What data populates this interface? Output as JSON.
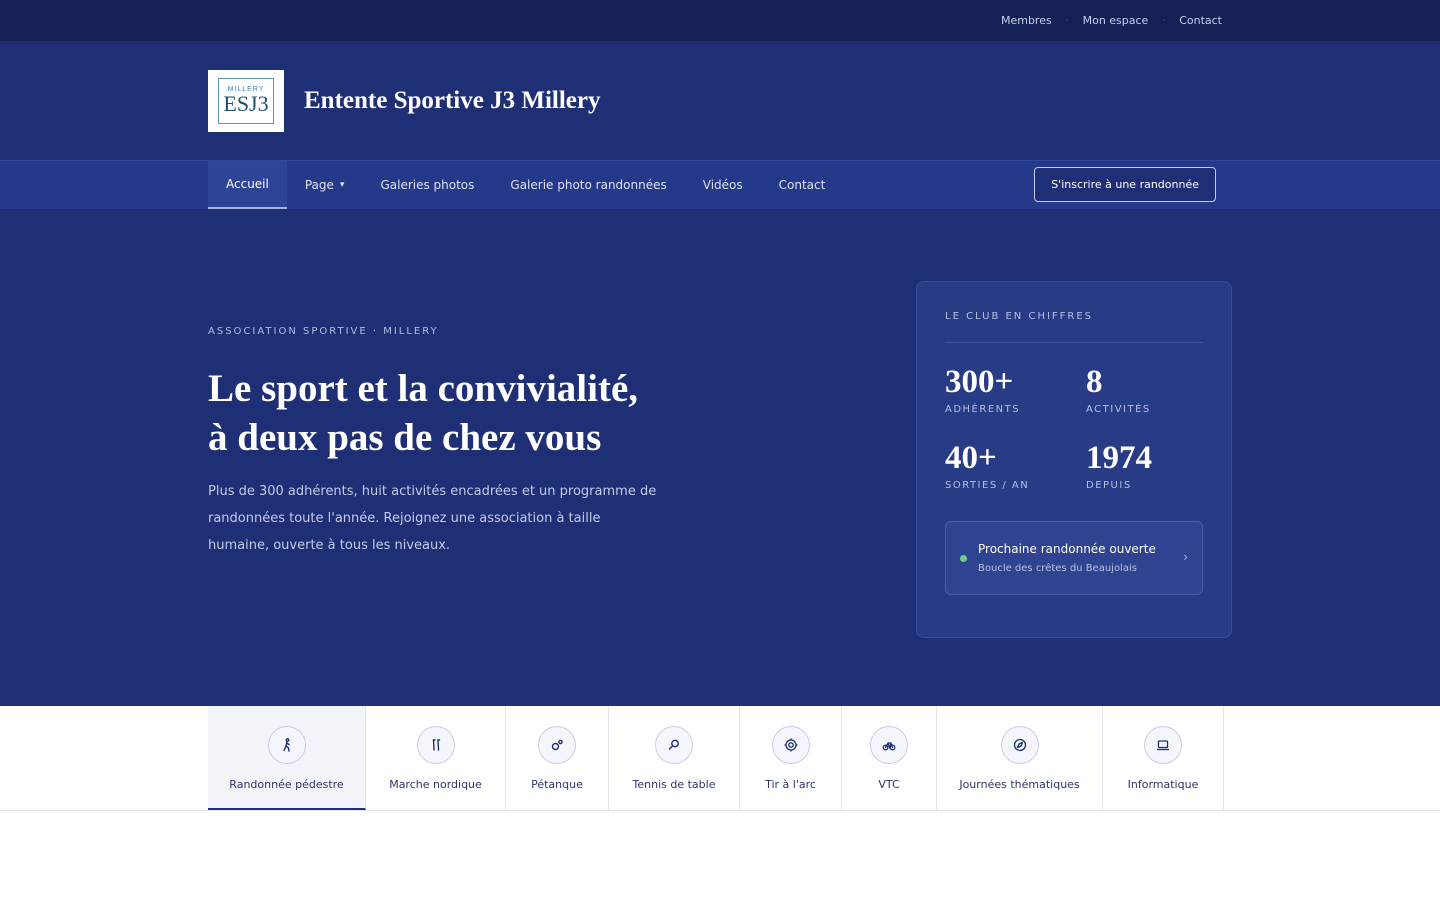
{
  "topbar": {
    "links": [
      "Membres",
      "Mon espace",
      "Contact"
    ]
  },
  "header": {
    "logo_top": "MILLERY",
    "logo_main": "ESJ3",
    "title": "Entente Sportive J3 Millery"
  },
  "nav": {
    "items": [
      "Accueil",
      "Page",
      "Galeries photos",
      "Galerie photo randonnées",
      "Vidéos",
      "Contact"
    ],
    "active": "Accueil",
    "cta": "S'inscrire à une randonnée"
  },
  "hero": {
    "kicker": "ASSOCIATION SPORTIVE · MILLERY",
    "headline_line1": "Le sport et la convivialité,",
    "headline_line2": "à deux pas de chez vous",
    "lead": "Plus de 300 adhérents, huit activités encadrées et un programme de randonnées toute l'année. Rejoignez une association à taille humaine, ouverte à tous les niveaux."
  },
  "card": {
    "title": "LE CLUB EN CHIFFRES",
    "stats": [
      {
        "value": "300+",
        "label": "ADHÉRENTS"
      },
      {
        "value": "8",
        "label": "ACTIVITÉS"
      },
      {
        "value": "40+",
        "label": "SORTIES / AN"
      },
      {
        "value": "1974",
        "label": "DEPUIS"
      }
    ],
    "next_title": "Prochaine randonnée ouverte",
    "next_sub": "Boucle des crêtes du Beaujolais",
    "colors": {
      "status_dot": "#6fcf8a"
    }
  },
  "activities": [
    {
      "label": "Randonnée pédestre",
      "icon": "hiker-icon"
    },
    {
      "label": "Marche nordique",
      "icon": "nordic-poles-icon"
    },
    {
      "label": "Pétanque",
      "icon": "boules-icon"
    },
    {
      "label": "Tennis de table",
      "icon": "paddle-icon"
    },
    {
      "label": "Tir à l'arc",
      "icon": "target-icon"
    },
    {
      "label": "VTC",
      "icon": "bike-icon"
    },
    {
      "label": "Journées thématiques",
      "icon": "compass-icon"
    },
    {
      "label": "Informatique",
      "icon": "laptop-icon"
    }
  ],
  "colors": {
    "brand_dark": "#152057",
    "brand": "#1f2f76",
    "nav": "#24398a"
  }
}
